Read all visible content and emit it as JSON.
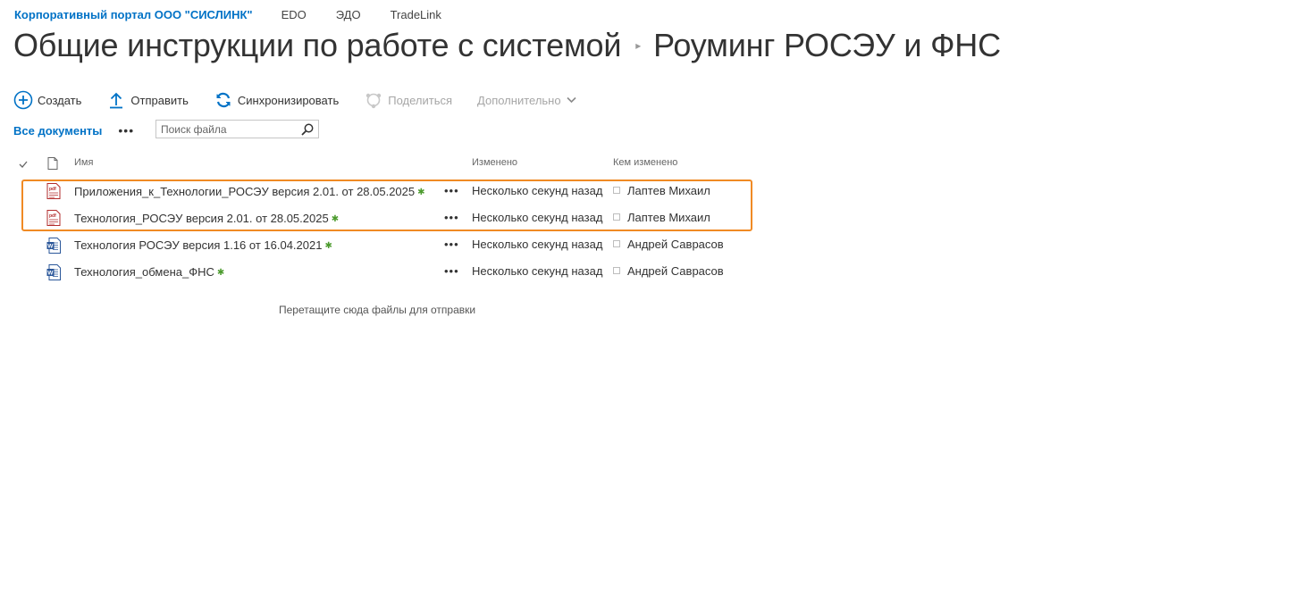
{
  "topnav": {
    "site": "Корпоративный портал ООО \"СИСЛИНК\"",
    "links": [
      "EDO",
      "ЭДО",
      "TradeLink"
    ]
  },
  "title": {
    "parent": "Общие инструкции по работе с системой",
    "current": "Роуминг РОСЭУ и ФНС"
  },
  "toolbar": {
    "create": "Создать",
    "upload": "Отправить",
    "sync": "Синхронизировать",
    "share": "Поделиться",
    "more": "Дополнительно"
  },
  "view": {
    "name": "Все документы",
    "search_placeholder": "Поиск файла"
  },
  "columns": {
    "name": "Имя",
    "modified": "Изменено",
    "modified_by": "Кем изменено"
  },
  "files": [
    {
      "name": "Приложения_к_Технологии_РОСЭУ версия 2.01. от 28.05.2025",
      "type": "pdf",
      "modified": "Несколько секунд назад",
      "modified_by": "Лаптев Михаил"
    },
    {
      "name": "Технология_РОСЭУ версия 2.01. от 28.05.2025",
      "type": "pdf",
      "modified": "Несколько секунд назад",
      "modified_by": "Лаптев Михаил"
    },
    {
      "name": "Технология РОСЭУ версия 1.16 от 16.04.2021",
      "type": "word",
      "modified": "Несколько секунд назад",
      "modified_by": "Андрей Саврасов"
    },
    {
      "name": "Технология_обмена_ФНС",
      "type": "word",
      "modified": "Несколько секунд назад",
      "modified_by": "Андрей Саврасов"
    }
  ],
  "drop_hint": "Перетащите сюда файлы для отправки",
  "colors": {
    "accent": "#0072c6",
    "highlight": "#f08a24",
    "new": "#4c9b2e"
  }
}
